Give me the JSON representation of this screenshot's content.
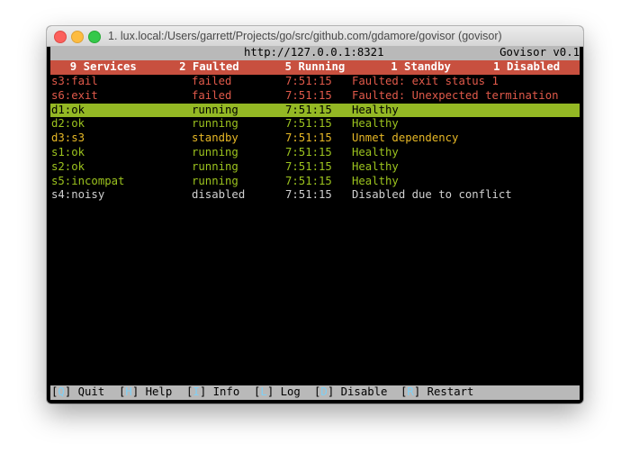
{
  "window": {
    "title": "1. lux.local:/Users/garrett/Projects/go/src/github.com/gdamore/govisor (govisor)"
  },
  "header": {
    "url": "http://127.0.0.1:8321",
    "version": "Govisor v0.1"
  },
  "stats": [
    "9 Services",
    "2 Faulted",
    "5 Running",
    "1 Standby",
    "1 Disabled"
  ],
  "services": [
    {
      "name": "s3:fail",
      "status": "failed",
      "time": "7:51:15",
      "message": "Faulted: exit status 1",
      "color": "red"
    },
    {
      "name": "s6:exit",
      "status": "failed",
      "time": "7:51:15",
      "message": "Faulted: Unexpected termination",
      "color": "red"
    },
    {
      "name": "d1:ok",
      "status": "running",
      "time": "7:51:15",
      "message": "Healthy",
      "color": "green",
      "selected": true
    },
    {
      "name": "d2:ok",
      "status": "running",
      "time": "7:51:15",
      "message": "Healthy",
      "color": "green"
    },
    {
      "name": "d3:s3",
      "status": "standby",
      "time": "7:51:15",
      "message": "Unmet dependency",
      "color": "yellow"
    },
    {
      "name": "s1:ok",
      "status": "running",
      "time": "7:51:15",
      "message": "Healthy",
      "color": "green"
    },
    {
      "name": "s2:ok",
      "status": "running",
      "time": "7:51:15",
      "message": "Healthy",
      "color": "green"
    },
    {
      "name": "s5:incompat",
      "status": "running",
      "time": "7:51:15",
      "message": "Healthy",
      "color": "green"
    },
    {
      "name": "s4:noisy",
      "status": "disabled",
      "time": "7:51:15",
      "message": "Disabled due to conflict",
      "color": "grey"
    }
  ],
  "footer": [
    {
      "key": "Q",
      "label": "Quit"
    },
    {
      "key": "H",
      "label": "Help"
    },
    {
      "key": "I",
      "label": "Info"
    },
    {
      "key": "L",
      "label": "Log"
    },
    {
      "key": "D",
      "label": "Disable"
    },
    {
      "key": "R",
      "label": "Restart"
    }
  ],
  "colors": {
    "faulted": "#e0594a",
    "running": "#9cc31e",
    "standby": "#e7b826",
    "disabled": "#d0d0d0",
    "stats_bar": "#c8503f",
    "key": "#7fd0f5"
  }
}
